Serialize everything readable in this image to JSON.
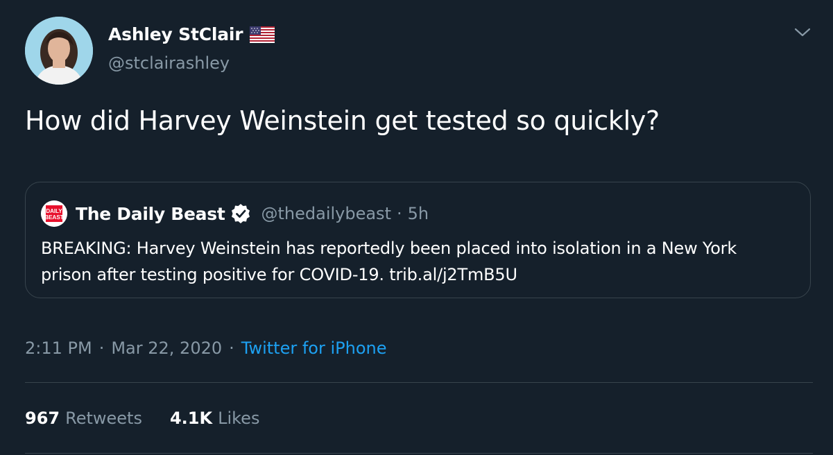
{
  "author": {
    "name": "Ashley StClair",
    "handle": "@stclairashley"
  },
  "tweet": {
    "text": "How did Harvey Weinstein get tested so quickly?"
  },
  "quoted_tweet": {
    "name": "The Daily Beast",
    "handle": "@thedailybeast",
    "separator": "·",
    "time": "5h",
    "text": "BREAKING: Harvey Weinstein has reportedly been placed into isolation in a New York prison after testing positive for COVID-19. trib.al/j2TmB5U",
    "avatar_logo": [
      "DAILY",
      "BEAST"
    ]
  },
  "meta": {
    "time": "2:11 PM",
    "separator": "·",
    "date": "Mar 22, 2020",
    "source": "Twitter for iPhone"
  },
  "stats": {
    "retweets_count": "967",
    "retweets_label": "Retweets",
    "likes_count": "4.1K",
    "likes_label": "Likes"
  },
  "icons": {
    "flag": "us-flag-icon",
    "verified": "verified-badge-icon",
    "caret": "chevron-down-icon"
  },
  "colors": {
    "background": "#15202b",
    "border": "#38444d",
    "secondary_text": "#8899a6",
    "link": "#1da1f2",
    "daily_beast_red": "#e8112d"
  }
}
